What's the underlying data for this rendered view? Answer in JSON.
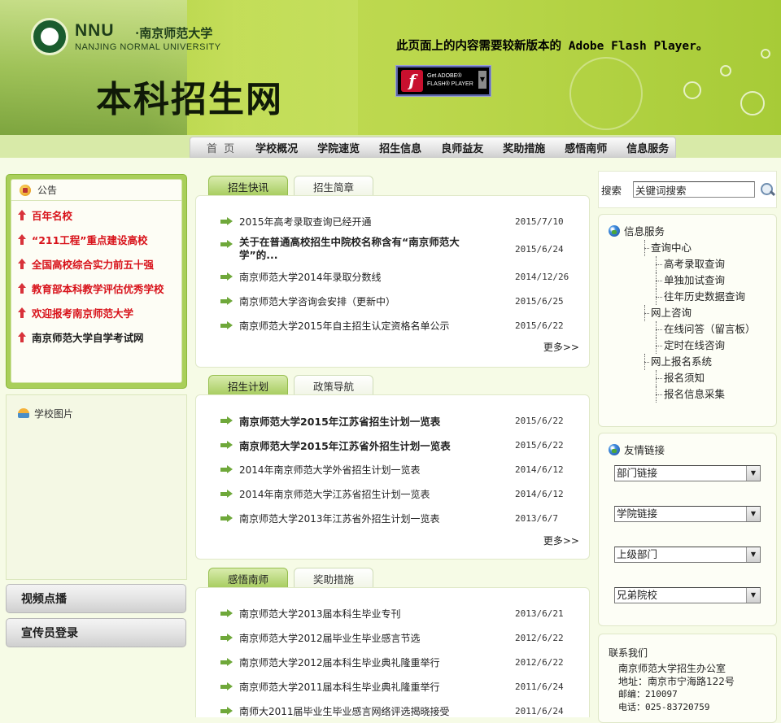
{
  "header": {
    "logo_en": "NNU",
    "logo_cn": "·南京师范大学",
    "logo_sub": "NANJING NORMAL UNIVERSITY",
    "site_title": "本科招生网",
    "flash_message": "此页面上的内容需要较新版本的 Adobe Flash Player。",
    "flash_button_line1": "Get ADOBE®",
    "flash_button_line2": "FLASH® PLAYER",
    "flash_button_icon": "f"
  },
  "nav": {
    "items": [
      {
        "label": "首 页"
      },
      {
        "label": "学校概况"
      },
      {
        "label": "学院速览"
      },
      {
        "label": "招生信息"
      },
      {
        "label": "良师益友"
      },
      {
        "label": "奖助措施"
      },
      {
        "label": "感悟南师"
      },
      {
        "label": "信息服务"
      }
    ]
  },
  "notice": {
    "title": "公告",
    "items": [
      {
        "label": "百年名校"
      },
      {
        "label": "“211工程”重点建设高校"
      },
      {
        "label": "全国高校综合实力前五十强"
      },
      {
        "label": "教育部本科教学评估优秀学校"
      },
      {
        "label": "欢迎报考南京师范大学"
      },
      {
        "label": "南京师范大学自学考试网"
      }
    ]
  },
  "photos": {
    "title": "学校图片"
  },
  "side_buttons": {
    "video": "视频点播",
    "login": "宣传员登录"
  },
  "section1": {
    "tabs": [
      "招生快讯",
      "招生简章"
    ],
    "items": [
      {
        "title": "2015年高考录取查询已经开通",
        "date": "2015/7/10"
      },
      {
        "title": "关于在普通高校招生中院校名称含有“南京师范大学”的...",
        "date": "2015/6/24"
      },
      {
        "title": "南京师范大学2014年录取分数线",
        "date": "2014/12/26"
      },
      {
        "title": "南京师范大学咨询会安排（更新中）",
        "date": "2015/6/25"
      },
      {
        "title": "南京师范大学2015年自主招生认定资格名单公示",
        "date": "2015/6/22"
      }
    ],
    "more": "更多>>"
  },
  "section2": {
    "tabs": [
      "招生计划",
      "政策导航"
    ],
    "items": [
      {
        "title": "南京师范大学2015年江苏省招生计划一览表",
        "date": "2015/6/22"
      },
      {
        "title": "南京师范大学2015年江苏省外招生计划一览表",
        "date": "2015/6/22"
      },
      {
        "title": "2014年南京师范大学外省招生计划一览表",
        "date": "2014/6/12"
      },
      {
        "title": "2014年南京师范大学江苏省招生计划一览表",
        "date": "2014/6/12"
      },
      {
        "title": "南京师范大学2013年江苏省外招生计划一览表",
        "date": "2013/6/7"
      }
    ],
    "more": "更多>>"
  },
  "section3": {
    "tabs": [
      "感悟南师",
      "奖助措施"
    ],
    "items": [
      {
        "title": "南京师范大学2013届本科生毕业专刊",
        "date": "2013/6/21"
      },
      {
        "title": "南京师范大学2012届毕业生毕业感言节选",
        "date": "2012/6/22"
      },
      {
        "title": "南京师范大学2012届本科生毕业典礼隆重举行",
        "date": "2012/6/22"
      },
      {
        "title": "南京师范大学2011届本科生毕业典礼隆重举行",
        "date": "2011/6/24"
      },
      {
        "title": "南师大2011届毕业生毕业感言网络评选揭晓接受",
        "date": "2011/6/24"
      }
    ]
  },
  "search": {
    "label": "搜索",
    "placeholder": "关键词搜索"
  },
  "info_service": {
    "title": "信息服务",
    "groups": [
      {
        "label": "查询中心",
        "children": [
          "高考录取查询",
          "单独加试查询",
          "往年历史数据查询"
        ]
      },
      {
        "label": "网上咨询",
        "children": [
          "在线问答（留言板）",
          "定时在线咨询"
        ]
      },
      {
        "label": "网上报名系统",
        "children": [
          "报名须知",
          "报名信息采集"
        ]
      }
    ]
  },
  "links": {
    "title": "友情链接",
    "selects": [
      "部门链接",
      "学院链接",
      "上级部门",
      "兄弟院校"
    ]
  },
  "contact": {
    "title": "联系我们",
    "org": "南京师范大学招生办公室",
    "address": "地址：南京市宁海路122号",
    "postcode": "邮编：210097",
    "phone": "电话：025-83720759"
  },
  "colors": {
    "accent_green": "#a6cc5e",
    "notice_red": "#d8121a",
    "header_green": "#b9d64a"
  }
}
